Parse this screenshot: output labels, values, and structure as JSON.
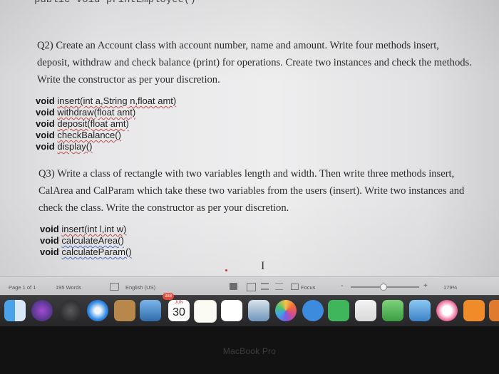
{
  "document": {
    "top_code": "public void printEmployee()",
    "q2": {
      "text": "Q2) Create an Account class with account number, name and amount. Write four methods insert, deposit, withdraw and check balance (print) for operations. Create two instances and check the methods. Write the constructor as per your discretion.",
      "code": [
        {
          "kw": "void ",
          "sig": "insert(int a,String n,float amt)"
        },
        {
          "kw": "void ",
          "sig": "withdraw(float amt)"
        },
        {
          "kw": "void ",
          "sig": "deposit(float amt)"
        },
        {
          "kw": "void ",
          "sig": "checkBalance()"
        },
        {
          "kw": "void ",
          "sig": "display()"
        }
      ]
    },
    "q3": {
      "text": "Q3) Write a class of rectangle with two variables length and width. Then write three methods insert, CalArea and CalParam which take these two variables from the users (insert). Write two instances and check the class. Write the constructor as per your discretion.",
      "code": [
        {
          "kw": "void ",
          "sig": "insert(int l,int w)"
        },
        {
          "kw": "void ",
          "sig": "calculateArea()"
        },
        {
          "kw": "void ",
          "sig": "calculateParam()"
        }
      ]
    },
    "cursor_glyph": "I"
  },
  "status_bar": {
    "page": "Page 1 of 1",
    "words": "195 Words",
    "language": "English (US)",
    "focus": "Focus",
    "zoom_minus": "-",
    "zoom_plus": "+",
    "zoom": "179%",
    "zoom_level_fraction": 0.48
  },
  "dock": {
    "calendar_month": "JUN",
    "calendar_day": "30",
    "calendar_badge": "388"
  },
  "bezel": {
    "brand": "MacBook Pro"
  },
  "colors": {
    "page_bg": "#eeeeef",
    "text": "#2b2b2b",
    "spell_underline": "#c84a4a",
    "status_bar_bg": "#cdcdcf",
    "dock_bg": "#2f2f31",
    "bezel_bg": "#121213"
  }
}
